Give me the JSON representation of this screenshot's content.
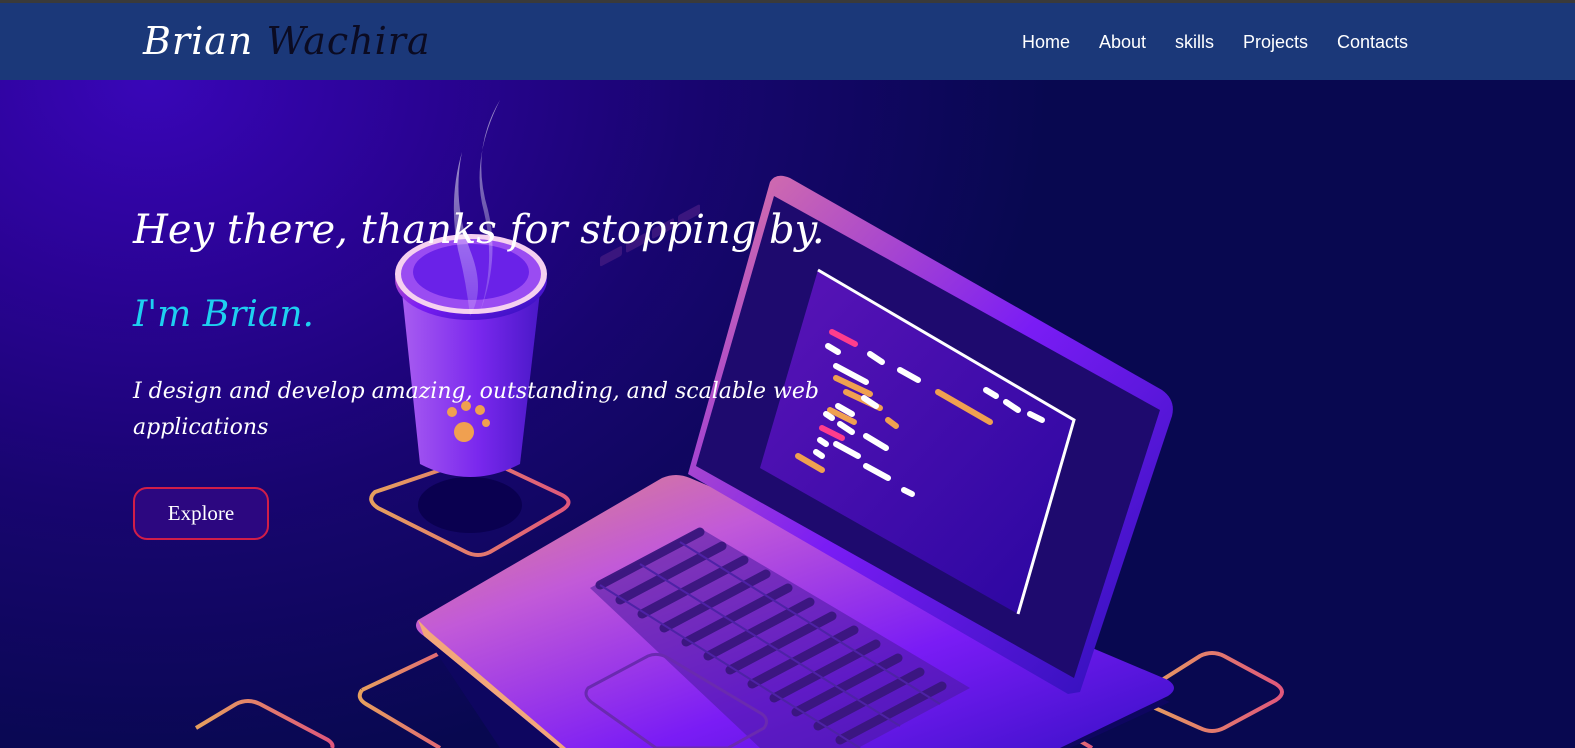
{
  "header": {
    "brand_first": "Brian",
    "brand_last": "Wachira",
    "nav": [
      {
        "label": "Home"
      },
      {
        "label": "About"
      },
      {
        "label": "skills"
      },
      {
        "label": "Projects"
      },
      {
        "label": "Contacts"
      }
    ]
  },
  "hero": {
    "greeting": "Hey there, thanks for stopping by.",
    "intro": "I'm Brian.",
    "tagline": "I design and develop amazing, outstanding, and scalable web applications",
    "cta_label": "Explore"
  },
  "illustration": {
    "subject": "isometric-laptop-with-coffee-cup",
    "colors": {
      "navbar": "#1b3879",
      "hero_bg": "#160470",
      "accent_cyan": "#1ed0f0",
      "button_border": "#d11e48"
    }
  }
}
